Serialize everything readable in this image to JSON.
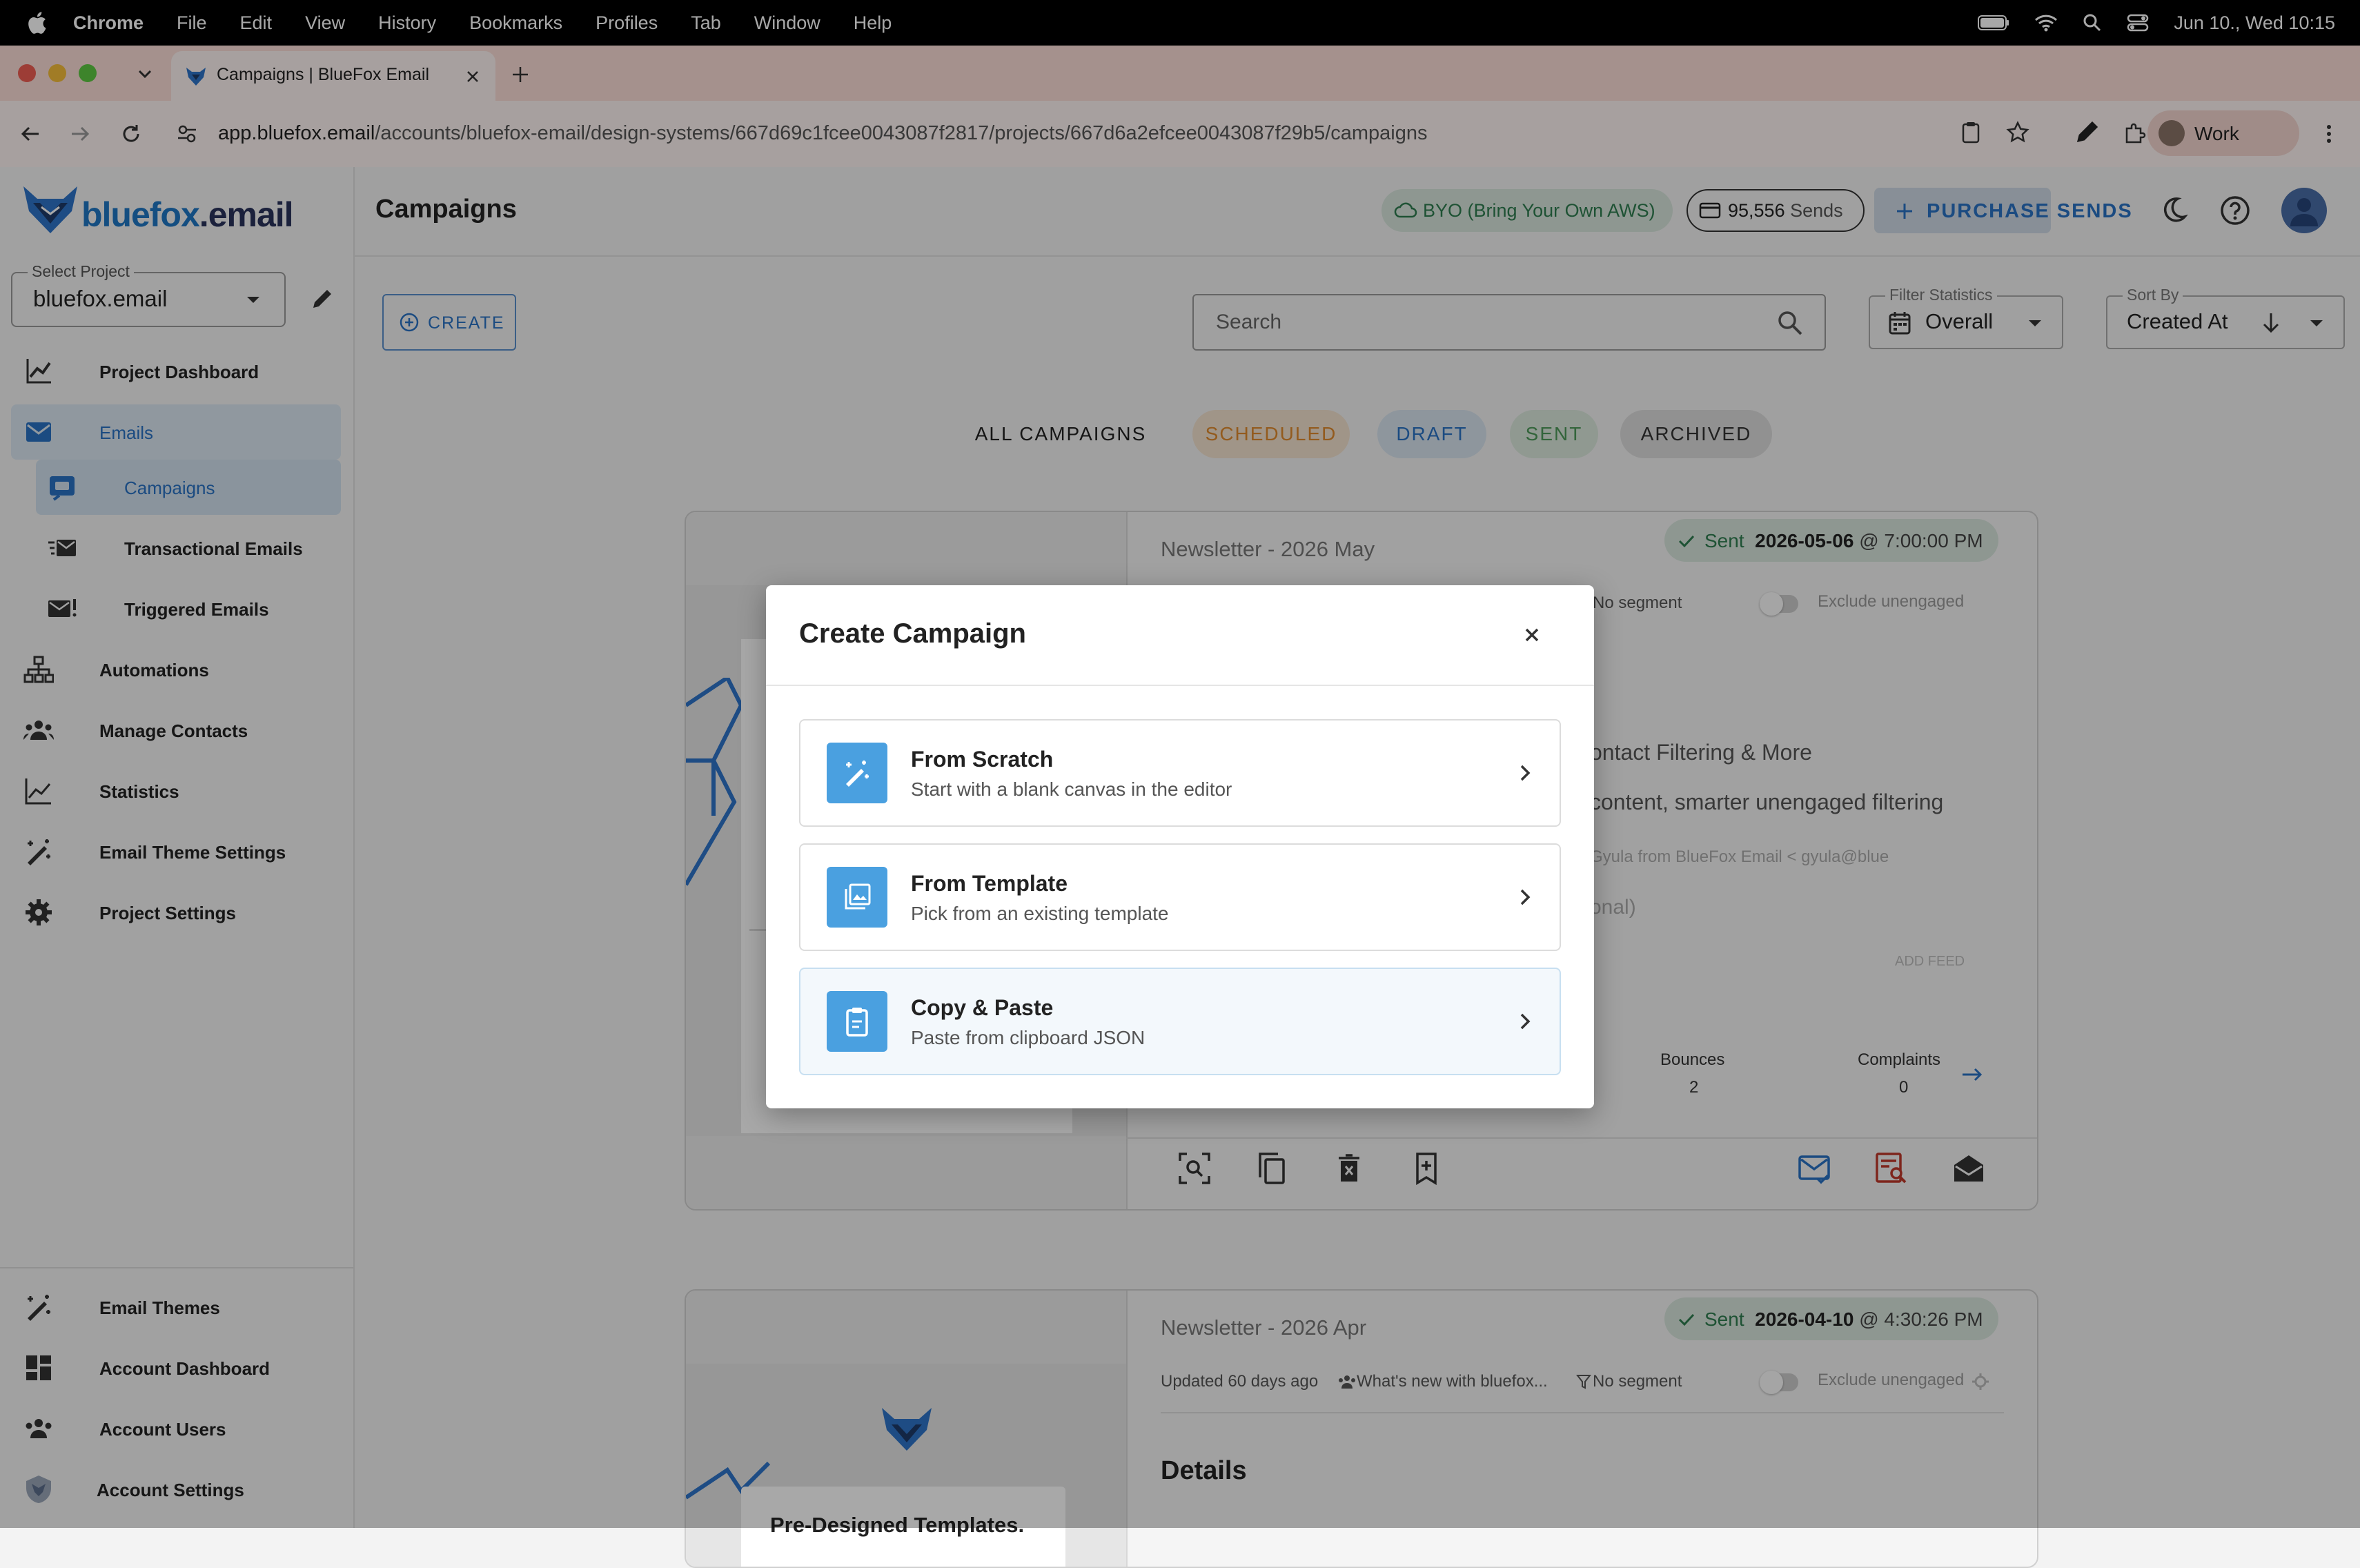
{
  "menubar": {
    "app": "Chrome",
    "items": [
      "File",
      "Edit",
      "View",
      "History",
      "Bookmarks",
      "Profiles",
      "Tab",
      "Window",
      "Help"
    ],
    "datetime": "Jun 10., Wed  10:15"
  },
  "browser": {
    "tab_title": "Campaigns | BlueFox Email",
    "url_host": "app.bluefox.email",
    "url_path": "/accounts/bluefox-email/design-systems/667d69c1fcee0043087f2817/projects/667d6a2efcee0043087f29b5/campaigns",
    "profile": "Work"
  },
  "sidebar": {
    "logo_main": "bluefox",
    "logo_suffix": ".email",
    "project_label": "Select Project",
    "project_value": "bluefox.email",
    "nav": [
      {
        "label": "Project Dashboard",
        "icon": "chart-icon"
      },
      {
        "label": "Emails",
        "icon": "mail-icon"
      },
      {
        "label": "Campaigns",
        "icon": "campaign-icon"
      },
      {
        "label": "Transactional Emails",
        "icon": "fast-mail-icon"
      },
      {
        "label": "Triggered Emails",
        "icon": "mail-alert-icon"
      },
      {
        "label": "Automations",
        "icon": "sitemap-icon"
      },
      {
        "label": "Manage Contacts",
        "icon": "people-icon"
      },
      {
        "label": "Statistics",
        "icon": "line-chart-icon"
      },
      {
        "label": "Email Theme Settings",
        "icon": "magic-wand-icon"
      },
      {
        "label": "Project Settings",
        "icon": "gear-icon"
      }
    ],
    "bottom_nav": [
      {
        "label": "Email Themes",
        "icon": "magic-wand-icon"
      },
      {
        "label": "Account Dashboard",
        "icon": "dashboard-icon"
      },
      {
        "label": "Account Users",
        "icon": "people-icon"
      },
      {
        "label": "Account Settings",
        "icon": "fox-shield-icon"
      }
    ]
  },
  "header": {
    "title": "Campaigns",
    "byo": "BYO (Bring Your Own AWS)",
    "sends_value": "95,556",
    "sends_unit": "Sends",
    "purchase": "PURCHASE SENDS"
  },
  "controls": {
    "create": "CREATE",
    "search_placeholder": "Search",
    "filter_label": "Filter Statistics",
    "filter_value": "Overall",
    "sort_label": "Sort By",
    "sort_value": "Created At"
  },
  "chips": [
    "ALL CAMPAIGNS",
    "SCHEDULED",
    "DRAFT",
    "SENT",
    "ARCHIVED"
  ],
  "colors": {
    "accent": "#2a72c4",
    "option_icon": "#4aa0e0",
    "scheduled": "#e08a2e",
    "sent_green": "#2e7d4f"
  },
  "cards": [
    {
      "name": "Newsletter - 2026 May",
      "status": "Sent",
      "date": "2026-05-06",
      "time": "@ 7:00:00 PM",
      "segment": "No segment",
      "exclude": "Exclude unengaged",
      "partial_title": "ontact Filtering & More",
      "partial_desc": "content, smarter unengaged filtering",
      "partial_from": "Gyula from BlueFox Email < gyula@blue",
      "partial_optional": "onal)",
      "add_feed": "ADD FEED",
      "bounces_label": "Bounces",
      "bounces_value": "2",
      "complaints_label": "Complaints",
      "complaints_value": "0"
    },
    {
      "name": "Newsletter - 2026 Apr",
      "status": "Sent",
      "date": "2026-04-10",
      "time": "@ 4:30:26 PM",
      "updated": "Updated 60 days ago",
      "subject_preview": "What's new with bluefox...",
      "segment": "No segment",
      "exclude": "Exclude unengaged",
      "details": "Details",
      "thumb_text": "Pre-Designed Templates."
    }
  ],
  "modal": {
    "title": "Create Campaign",
    "options": [
      {
        "title": "From Scratch",
        "desc": "Start with a blank canvas in the editor",
        "icon": "magic-wand-icon"
      },
      {
        "title": "From Template",
        "desc": "Pick from an existing template",
        "icon": "image-gallery-icon"
      },
      {
        "title": "Copy & Paste",
        "desc": "Paste from clipboard JSON",
        "icon": "clipboard-icon"
      }
    ]
  }
}
